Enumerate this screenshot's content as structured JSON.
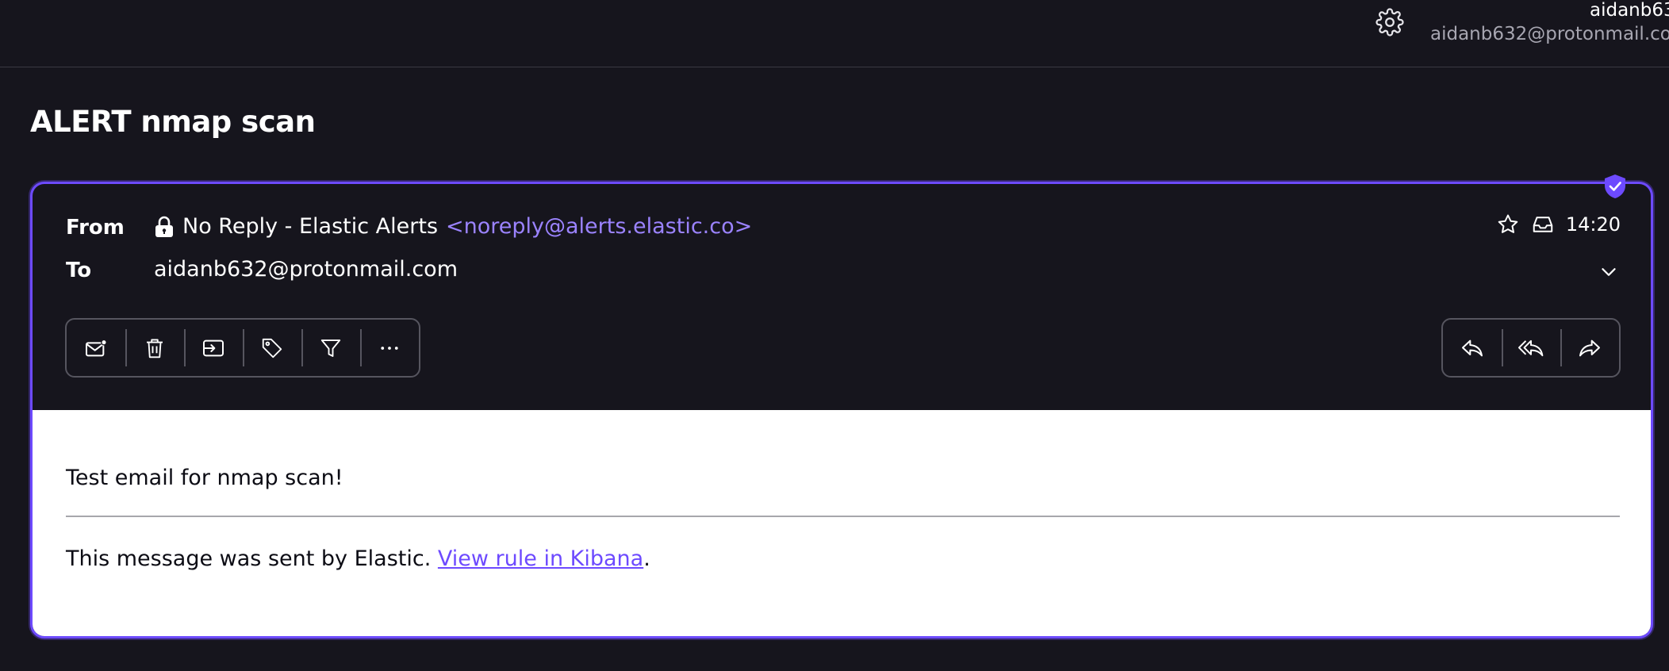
{
  "header": {
    "user_name": "aidanb63",
    "user_email": "aidanb632@protonmail.co",
    "settings_icon": "gear-icon"
  },
  "message": {
    "subject": "ALERT nmap scan",
    "from_label": "From",
    "to_label": "To",
    "sender_name": "No Reply - Elastic Alerts",
    "sender_address": "<noreply@alerts.elastic.co>",
    "recipient": "aidanb632@protonmail.com",
    "time": "14:20",
    "body_text": "Test email for nmap scan!",
    "footer_prefix": "This message was sent by Elastic. ",
    "footer_link": "View rule in Kibana",
    "footer_suffix": "."
  },
  "toolbar_left": [
    "mark-unread-icon",
    "trash-icon",
    "move-icon",
    "label-icon",
    "filter-icon",
    "more-icon"
  ],
  "toolbar_right": [
    "reply-icon",
    "reply-all-icon",
    "forward-icon"
  ],
  "colors": {
    "accent": "#6d4aff",
    "background": "#16151d",
    "link": "#9b83ff"
  }
}
